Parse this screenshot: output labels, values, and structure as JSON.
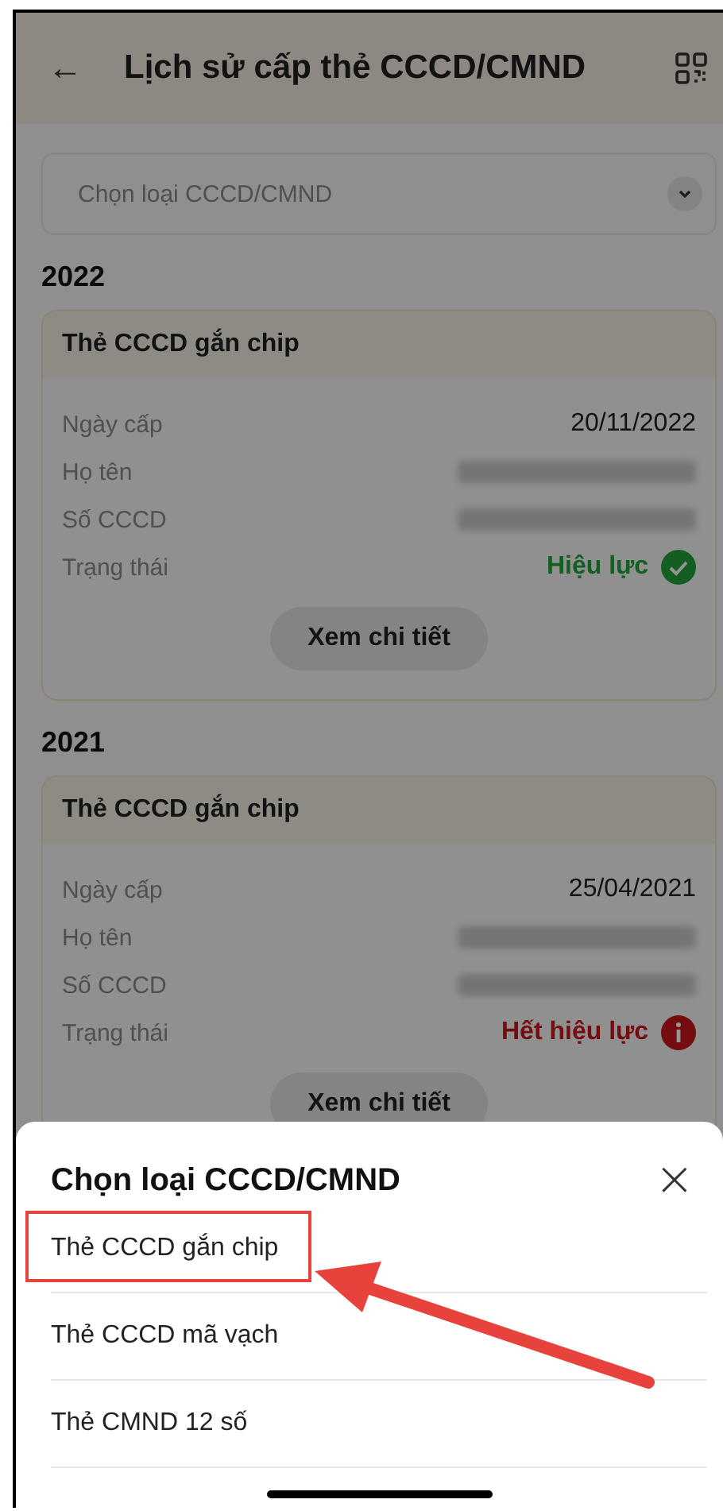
{
  "header": {
    "back": "←",
    "title": "Lịch sử cấp thẻ CCCD/CMND"
  },
  "dropdown": {
    "placeholder": "Chọn loại CCCD/CMND"
  },
  "sections": [
    {
      "year": "2022",
      "card": {
        "title": "Thẻ CCCD gắn chip",
        "rows": [
          {
            "kind": "text",
            "label": "Ngày cấp",
            "value": "20/11/2022"
          },
          {
            "kind": "redacted",
            "label": "Họ tên"
          },
          {
            "kind": "redacted",
            "label": "Số CCCD"
          },
          {
            "kind": "valid",
            "label": "Trạng thái",
            "value": "Hiệu lực"
          }
        ],
        "button": "Xem chi tiết"
      }
    },
    {
      "year": "2021",
      "card": {
        "title": "Thẻ CCCD gắn chip",
        "rows": [
          {
            "kind": "text",
            "label": "Ngày cấp",
            "value": "25/04/2021"
          },
          {
            "kind": "redacted",
            "label": "Họ tên"
          },
          {
            "kind": "redacted",
            "label": "Số CCCD"
          },
          {
            "kind": "expired",
            "label": "Trạng thái",
            "value": "Hết hiệu lực"
          }
        ],
        "button": "Xem chi tiết"
      }
    }
  ],
  "sheet": {
    "title": "Chọn loại CCCD/CMND",
    "close": "×",
    "items": [
      {
        "label": "Thẻ CCCD gắn chip",
        "highlighted": true
      },
      {
        "label": "Thẻ CCCD mã vạch",
        "highlighted": false
      },
      {
        "label": "Thẻ CMND 12 số",
        "highlighted": false
      }
    ]
  }
}
